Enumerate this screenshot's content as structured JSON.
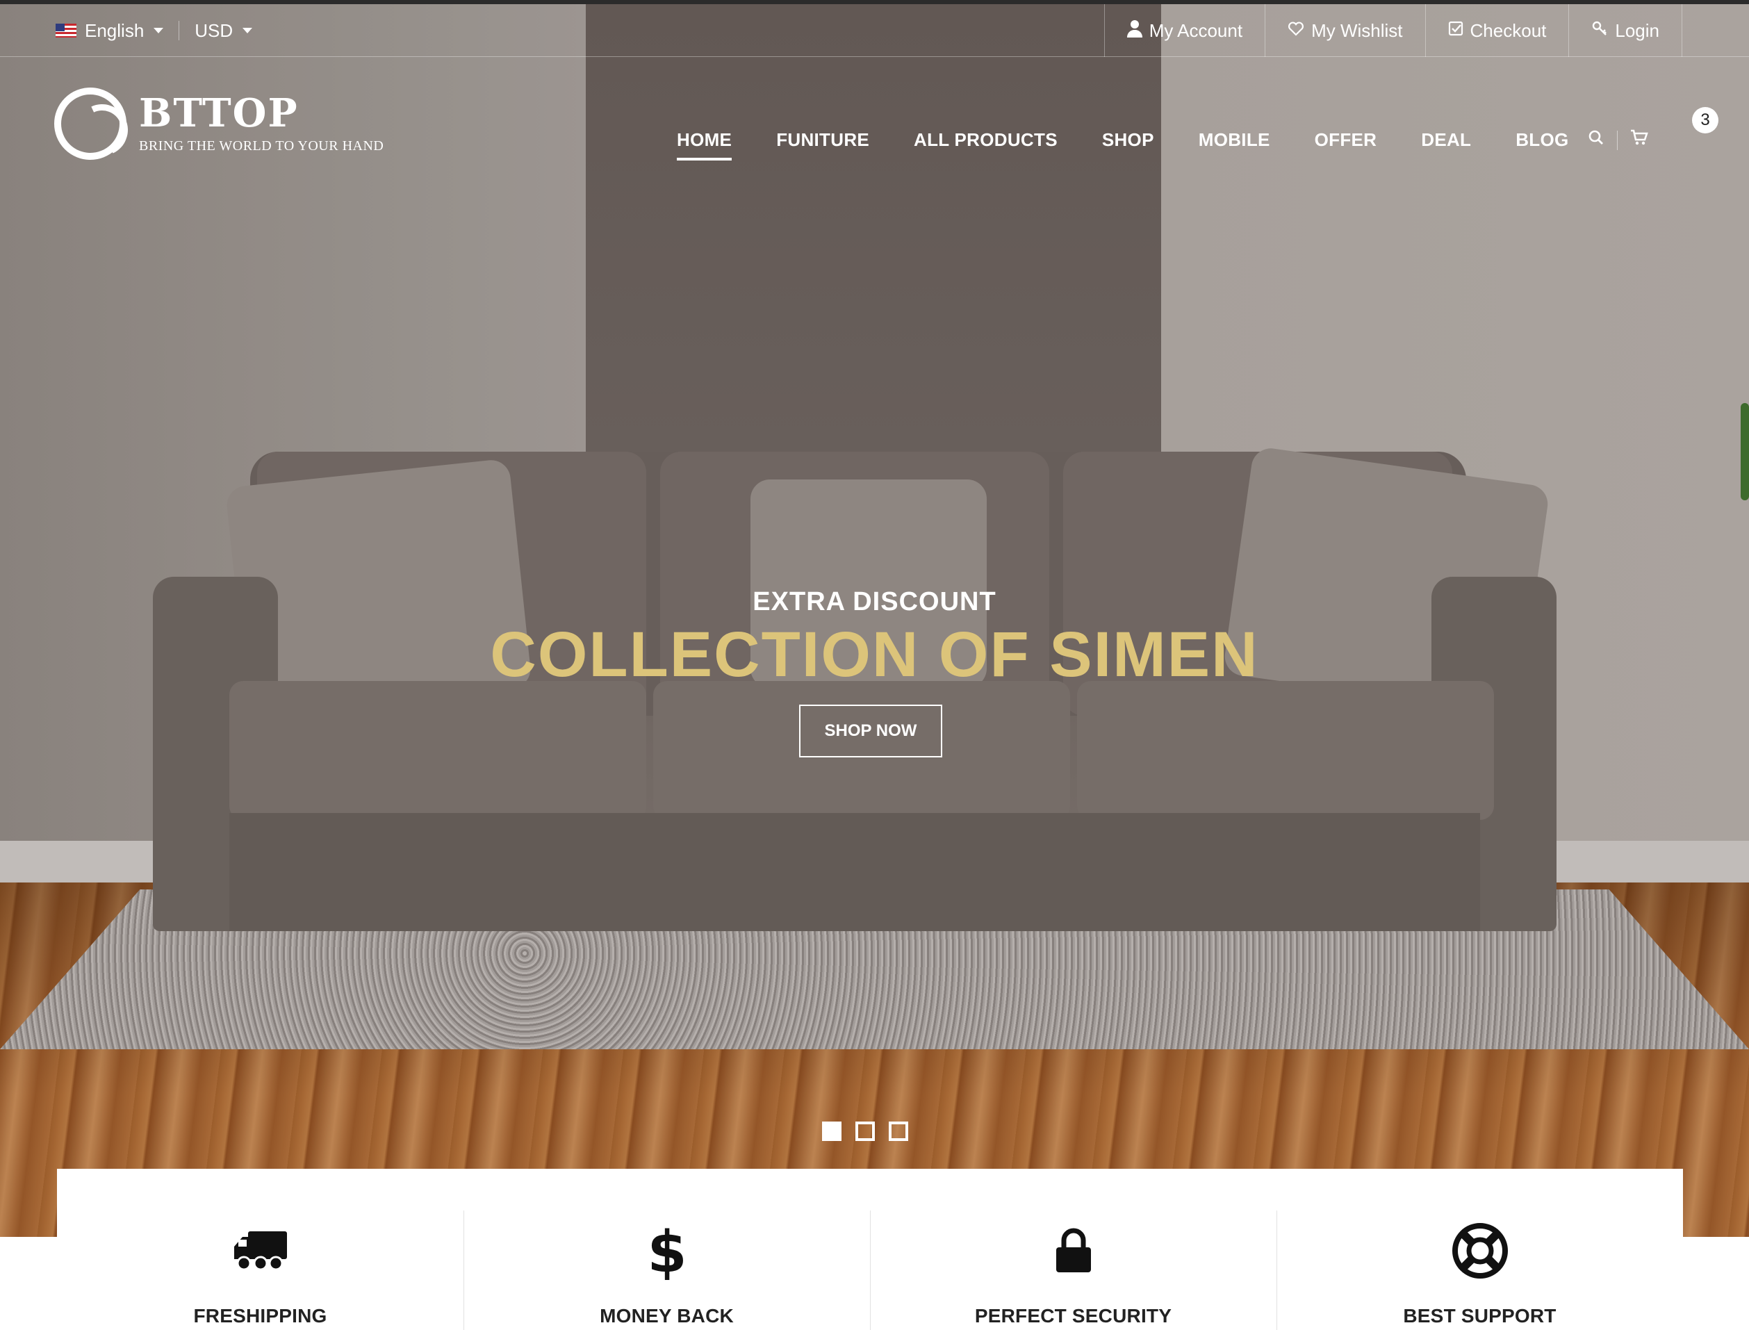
{
  "topbar": {
    "language": "English",
    "currency": "USD",
    "links": [
      {
        "label": "My Account",
        "icon": "user-icon"
      },
      {
        "label": "My Wishlist",
        "icon": "heart-icon"
      },
      {
        "label": "Checkout",
        "icon": "check-square-icon"
      },
      {
        "label": "Login",
        "icon": "key-icon"
      }
    ]
  },
  "logo": {
    "name": "BTTOP",
    "tagline": "BRING THE WORLD TO YOUR HAND"
  },
  "nav": {
    "items": [
      "HOME",
      "FUNITURE",
      "ALL PRODUCTS",
      "SHOP",
      "MOBILE",
      "OFFER",
      "DEAL",
      "BLOG"
    ],
    "active": "HOME"
  },
  "header": {
    "cart_count": "3"
  },
  "hero": {
    "kicker": "EXTRA DISCOUNT",
    "headline": "COLLECTION OF SIMEN",
    "cta": "SHOP NOW",
    "slides": 3,
    "active_slide": 1,
    "accent_color": "#dcc47a"
  },
  "features": [
    {
      "title": "FRESHIPPING",
      "icon": "truck-icon"
    },
    {
      "title": "MONEY BACK",
      "icon": "dollar-icon"
    },
    {
      "title": "PERFECT SECURITY",
      "icon": "lock-icon"
    },
    {
      "title": "BEST SUPPORT",
      "icon": "lifebuoy-icon"
    }
  ]
}
